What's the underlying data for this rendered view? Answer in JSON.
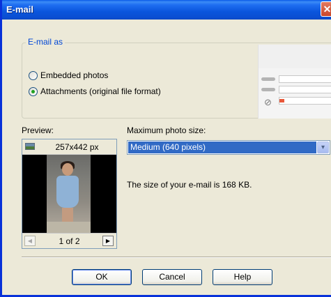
{
  "window": {
    "title": "E-mail",
    "close_glyph": "✕"
  },
  "email_as": {
    "legend": "E-mail as",
    "options": [
      {
        "label": "Embedded photos",
        "checked": false
      },
      {
        "label": "Attachments (original file format)",
        "checked": true
      }
    ]
  },
  "preview": {
    "label": "Preview:",
    "dimensions": "257x442 px",
    "page_indicator": "1 of 2",
    "prev_glyph": "◀",
    "next_glyph": "▶"
  },
  "photo_size": {
    "label": "Maximum photo size:",
    "selected": "Medium (640 pixels)",
    "dropdown_glyph": "▾"
  },
  "size_message": "The size of your e-mail is 168 KB.",
  "buttons": {
    "ok": "OK",
    "cancel": "Cancel",
    "help": "Help"
  },
  "colors": {
    "titlebar": "#0a55dc",
    "window_bg": "#ece9d8",
    "selection": "#316ac5",
    "legend_text": "#0046d5"
  }
}
